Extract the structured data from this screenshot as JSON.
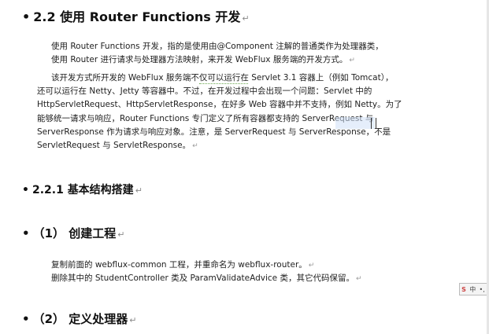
{
  "document": {
    "section_2_2": {
      "bullet": "•",
      "title": "2.2 使用 Router Functions 开发",
      "para1": [
        "使用 Router Functions 开发，指的是使用由@Component 注解的普通类作为处理器类，",
        "使用 Router 进行请求与处理器方法映射，来开发 WebFlux 服务端的开发方式。"
      ],
      "para2": [
        "该开发方式所开发的 WebFlux 服务端不仅可以运行在 Servlet 3.1 容器上（例如 Tomcat），",
        "还可以运行在 Netty、Jetty 等容器中。不过，在开发过程中会出现一个问题：Servlet 中的",
        "HttpServletRequest、HttpServletResponse，在好多 Web 容器中并不支持，例如 Netty。为了",
        "能够统一请求与响应，Router Functions 专门定义了所有容器都支持的 ServerRequest 与",
        "ServerResponse 作为请求与响应对象。注意，是 ServerRequest 与 ServerResponse，不是",
        "ServletRequest 与 ServletResponse。"
      ]
    },
    "section_2_2_1": {
      "bullet": "•",
      "title": "2.2.1   基本结构搭建"
    },
    "step1": {
      "bullet": "•",
      "title": "（1） 创建工程",
      "lines": [
        "复制前面的 webflux-common 工程，并重命名为 webflux-router。",
        "删除其中的 StudentController 类及 ParamValidateAdvice 类，其它代码保留。"
      ]
    },
    "step2": {
      "bullet": "•",
      "title": "（2） 定义处理器"
    },
    "return_mark": "↵",
    "heading_mark": "↵"
  },
  "ime_toolbar": {
    "label_s": "S",
    "label_zh": "中",
    "label_dot": "•,"
  }
}
